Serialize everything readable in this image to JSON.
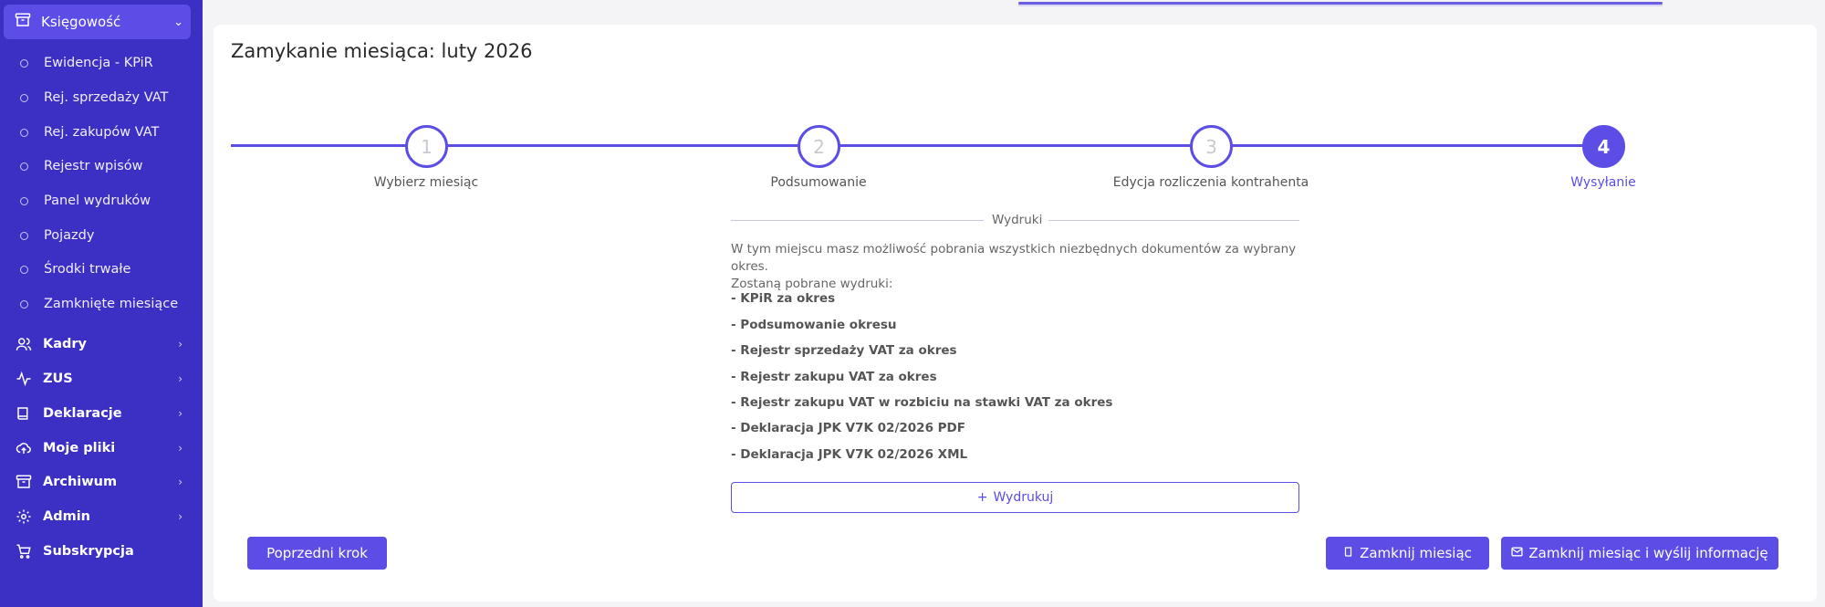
{
  "sidebar": {
    "active": {
      "label": "Księgowość",
      "icon": "archive-icon"
    },
    "subitems": [
      {
        "label": "Ewidencja - KPiR"
      },
      {
        "label": "Rej. sprzedaży VAT"
      },
      {
        "label": "Rej. zakupów VAT"
      },
      {
        "label": "Rejestr wpisów"
      },
      {
        "label": "Panel wydruków"
      },
      {
        "label": "Pojazdy"
      },
      {
        "label": "Środki trwałe"
      },
      {
        "label": "Zamknięte miesiące"
      }
    ],
    "items": [
      {
        "label": "Kadry",
        "icon": "users-icon"
      },
      {
        "label": "ZUS",
        "icon": "activity-icon"
      },
      {
        "label": "Deklaracje",
        "icon": "book-icon"
      },
      {
        "label": "Moje pliki",
        "icon": "cloud-upload-icon"
      },
      {
        "label": "Archiwum",
        "icon": "archive-icon"
      },
      {
        "label": "Admin",
        "icon": "gear-icon"
      },
      {
        "label": "Subskrypcja",
        "icon": "cart-icon"
      }
    ]
  },
  "page": {
    "title": "Zamykanie miesiąca: luty 2026"
  },
  "stepper": {
    "steps": [
      {
        "number": "1",
        "label": "Wybierz miesiąc"
      },
      {
        "number": "2",
        "label": "Podsumowanie"
      },
      {
        "number": "3",
        "label": "Edycja rozliczenia kontrahenta"
      },
      {
        "number": "4",
        "label": "Wysyłanie"
      }
    ],
    "active_index": 3
  },
  "printouts": {
    "section_title": "Wydruki",
    "intro_line1": "W tym miejscu masz możliwość pobrania wszystkich niezbędnych dokumentów za wybrany okres.",
    "intro_line2": "Zostaną pobrane wydruki:",
    "items": [
      "- KPiR za okres",
      "- Podsumowanie okresu",
      "- Rejestr sprzedaży VAT za okres",
      "- Rejestr zakupu VAT za okres",
      "- Rejestr zakupu VAT w rozbiciu na stawki VAT za okres",
      "- Deklaracja JPK V7K 02/2026 PDF",
      "- Deklaracja JPK V7K 02/2026 XML"
    ],
    "print_button": "Wydrukuj"
  },
  "actions": {
    "previous": "Poprzedni krok",
    "close_month": "Zamknij miesiąc",
    "close_and_send": "Zamknij miesiąc i wyślij informację"
  },
  "colors": {
    "sidebar_bg": "#3b2fc4",
    "accent": "#5b4de6"
  }
}
